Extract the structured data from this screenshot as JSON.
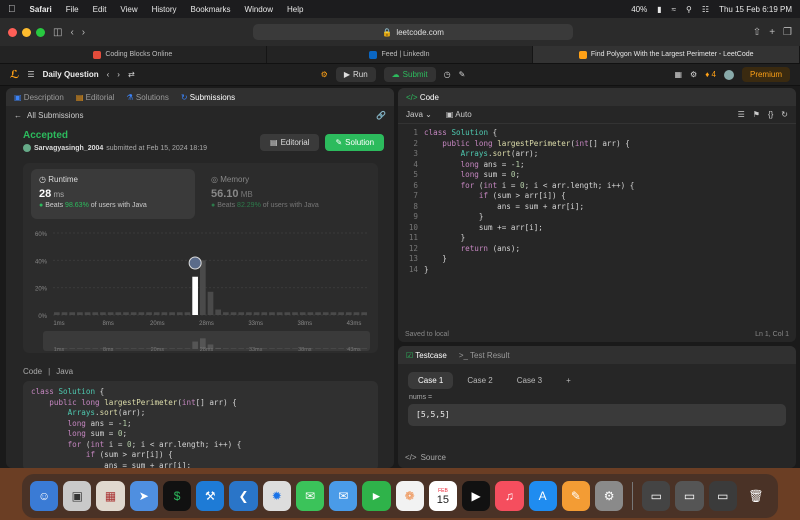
{
  "menubar": {
    "app": "Safari",
    "items": [
      "File",
      "Edit",
      "View",
      "History",
      "Bookmarks",
      "Window",
      "Help"
    ],
    "battery": "40%",
    "datetime": "Thu 15 Feb  6:19 PM"
  },
  "browser": {
    "url": "leetcode.com",
    "tabs": [
      {
        "label": "Coding Blocks Online",
        "color": "#e24c3b"
      },
      {
        "label": "Feed | LinkedIn",
        "color": "#0a66c2"
      },
      {
        "label": "Find Polygon With the Largest Perimeter - LeetCode",
        "color": "#ffa116"
      }
    ]
  },
  "lcnav": {
    "daily": "Daily Question",
    "run": "Run",
    "submit": "Submit",
    "streak": "4",
    "premium": "Premium"
  },
  "left": {
    "tabs": [
      "Description",
      "Editorial",
      "Solutions",
      "Submissions"
    ],
    "back": "All Submissions",
    "status": "Accepted",
    "user": "Sarvagyasingh_2004",
    "submitted": "submitted at Feb 15, 2024 18:19",
    "editorial_btn": "Editorial",
    "solution_btn": "Solution",
    "runtime": {
      "label": "Runtime",
      "value": "28",
      "unit": "ms",
      "beats_prefix": "Beats",
      "beats": "98.63%",
      "beats_suffix": "of users with Java"
    },
    "memory": {
      "label": "Memory",
      "value": "56.10",
      "unit": "MB",
      "beats_prefix": "Beats",
      "beats": "82.29%",
      "beats_suffix": "of users with Java"
    },
    "code_label": "Code",
    "code_lang": "Java"
  },
  "chart_data": {
    "type": "bar",
    "yticks": [
      "60%",
      "40%",
      "20%",
      "0%"
    ],
    "xticks": [
      "1ms",
      "8ms",
      "20ms",
      "28ms",
      "33ms",
      "38ms",
      "43ms"
    ],
    "ylim": [
      0,
      60
    ],
    "values": [
      2,
      2,
      2,
      2,
      2,
      2,
      2,
      2,
      2,
      2,
      2,
      2,
      2,
      2,
      2,
      2,
      2,
      2,
      28,
      40,
      17,
      4,
      2,
      2,
      2,
      2,
      2,
      2,
      2,
      2,
      2,
      2,
      2,
      2,
      2,
      2,
      2,
      2,
      2,
      2,
      2
    ],
    "highlight_index": 18
  },
  "editor": {
    "tab": "Code",
    "lang": "Java",
    "mode": "Auto",
    "saved": "Saved to local",
    "cursor": "Ln 1, Col 1",
    "line_numbers": [
      "1",
      "2",
      "3",
      "4",
      "5",
      "6",
      "7",
      "8",
      "9",
      "10",
      "11",
      "12",
      "13",
      "14"
    ]
  },
  "testcase": {
    "tab1": "Testcase",
    "tab2": "Test Result",
    "cases": [
      "Case 1",
      "Case 2",
      "Case 3"
    ],
    "var_label": "nums =",
    "var_value": "[5,5,5]",
    "source": "Source"
  },
  "dock": {
    "calendar_month": "FEB",
    "calendar_day": "15"
  }
}
